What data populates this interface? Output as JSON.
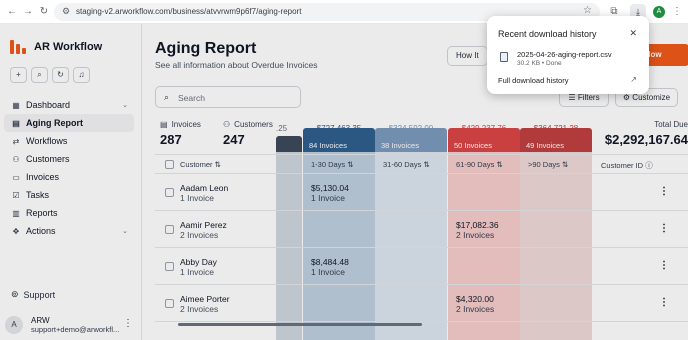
{
  "browser": {
    "url": "staging-v2.arworkflow.com/business/atvvrwm9p6f7/aging-report",
    "avatar_letter": "A"
  },
  "sidebar": {
    "brand": "AR Workflow",
    "items": [
      {
        "label": "Dashboard",
        "icon": "grid-icon"
      },
      {
        "label": "Aging Report",
        "icon": "report-icon"
      },
      {
        "label": "Workflows",
        "icon": "workflow-icon"
      },
      {
        "label": "Customers",
        "icon": "users-icon"
      },
      {
        "label": "Invoices",
        "icon": "invoice-icon"
      },
      {
        "label": "Tasks",
        "icon": "tasks-icon"
      },
      {
        "label": "Reports",
        "icon": "chart-icon"
      },
      {
        "label": "Actions",
        "icon": "actions-icon"
      }
    ],
    "support": "Support",
    "user": {
      "initial": "A",
      "name": "ARW",
      "email": "support+demo@arworkfl..."
    }
  },
  "main": {
    "title": "Aging Report",
    "subtitle": "See all information about Overdue Invoices",
    "how_it": "How It",
    "cta": "rkflow",
    "search_placeholder": "Search",
    "filters": "Filters",
    "customize": "Customize",
    "stats": {
      "invoices_label": "Invoices",
      "invoices_value": "287",
      "customers_label": "Customers",
      "customers_value": "247",
      "total_label": "Total Due",
      "total_value": "$2,292,167.64"
    },
    "partial_amount": ".25",
    "buckets": [
      {
        "amount": "$727,463.35",
        "invoices": "84 Invoices",
        "label": "1-30 Days",
        "color": "#2f5f8f",
        "light": "#bfd0e0"
      },
      {
        "amount": "$324,592.00",
        "invoices": "38 Invoices",
        "label": "31-60 Days",
        "color": "#7b9bbd",
        "light": "#dde6ef"
      },
      {
        "amount": "$429,237.76",
        "invoices": "50 Invoices",
        "label": "61-90 Days",
        "color": "#dc4545",
        "light": "#f7cccc"
      },
      {
        "amount": "$364,721.28",
        "invoices": "49 Invoices",
        "label": ">90 Days",
        "color": "#c04040",
        "light": "#f0dada"
      }
    ],
    "columns": {
      "customer": "Customer",
      "customer_id": "Customer ID"
    },
    "rows": [
      {
        "name": "Aadam Leon",
        "sub": "1 Invoice",
        "b1_amount": "$5,130.04",
        "b1_invs": "1 Invoice",
        "b3_amount": "",
        "b3_invs": ""
      },
      {
        "name": "Aamir Perez",
        "sub": "2 Invoices",
        "b1_amount": "",
        "b1_invs": "",
        "b3_amount": "$17,082.36",
        "b3_invs": "2 Invoices"
      },
      {
        "name": "Abby Day",
        "sub": "1 Invoice",
        "b1_amount": "$8,484.48",
        "b1_invs": "1 Invoice",
        "b3_amount": "",
        "b3_invs": ""
      },
      {
        "name": "Aimee Porter",
        "sub": "2 Invoices",
        "b1_amount": "",
        "b1_invs": "",
        "b3_amount": "$4,320.00",
        "b3_invs": "2 Invoices"
      }
    ]
  },
  "download_popup": {
    "title": "Recent download history",
    "file_name": "2025-04-26-aging-report.csv",
    "file_meta": "30.2 KB • Done",
    "full_history": "Full download history"
  }
}
